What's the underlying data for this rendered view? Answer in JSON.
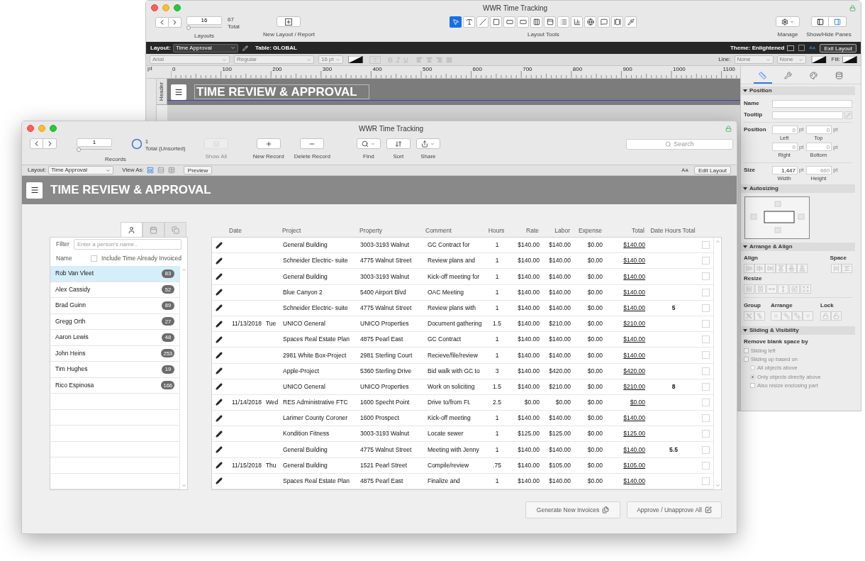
{
  "back_window": {
    "title": "WWR Time Tracking",
    "toolbar": {
      "layout_slider": {
        "value": "16",
        "level": 0.0
      },
      "layout_total": "67",
      "total_label": "Total",
      "layouts_label": "Layouts",
      "new_layout_label": "New Layout / Report",
      "layout_tools_label": "Layout Tools",
      "manage_label": "Manage",
      "panes_label": "Show/Hide Panes",
      "tools": [
        {
          "kind": "pointer",
          "selected": true
        },
        {
          "kind": "text",
          "selected": false
        },
        {
          "kind": "line",
          "selected": false
        },
        {
          "kind": "shape",
          "selected": false
        },
        {
          "kind": "field",
          "selected": false
        },
        {
          "kind": "button",
          "selected": false
        },
        {
          "kind": "button_bar",
          "selected": false
        },
        {
          "kind": "tab",
          "selected": false
        },
        {
          "kind": "portal",
          "selected": false
        },
        {
          "kind": "chart",
          "selected": false
        },
        {
          "kind": "web",
          "selected": false
        },
        {
          "kind": "popover",
          "selected": false
        },
        {
          "kind": "slide",
          "selected": false
        },
        {
          "kind": "eyedropper",
          "selected": false
        }
      ]
    },
    "layout_bar": {
      "layout_label": "Layout:",
      "layout": "Time Approval",
      "table": "Table: GLOBAL",
      "theme": "Theme: Enlightened",
      "exit": "Exit Layout"
    },
    "format_bar": {
      "font": "Arial",
      "style": "Regular",
      "size": "16 pt",
      "line_label": "Line:",
      "line": "None",
      "line_2": "None",
      "fill_label": "Fill:"
    },
    "ruler": {
      "unit": "pt",
      "ticks": [
        "0",
        "100",
        "200",
        "300",
        "400",
        "500",
        "600",
        "700",
        "800",
        "900",
        "1000",
        "1100"
      ]
    },
    "part_label": "Header",
    "header_title": "TIME REVIEW & APPROVAL",
    "inspector": {
      "tabs": [
        {
          "kind": "position",
          "selected": true
        },
        {
          "kind": "styles",
          "selected": false
        },
        {
          "kind": "appearance",
          "selected": false
        },
        {
          "kind": "data",
          "selected": false
        }
      ],
      "position": {
        "title": "Position",
        "name_label": "Name",
        "tooltip_label": "Tooltip",
        "position_label": "Position",
        "size_label": "Size",
        "position_fields": [
          {
            "value": "0",
            "unit": "pt",
            "label": "Left",
            "disabled": true
          },
          {
            "value": "0",
            "unit": "pt",
            "label": "Top",
            "disabled": true
          },
          {
            "value": "0",
            "unit": "pt",
            "label": "Right",
            "disabled": true
          },
          {
            "value": "0",
            "unit": "pt",
            "label": "Bottom",
            "disabled": true
          }
        ],
        "size_fields": [
          {
            "value": "1,447",
            "unit": "pt",
            "label": "Width",
            "disabled": false
          },
          {
            "value": "660",
            "unit": "pt",
            "label": "Height",
            "disabled": true
          }
        ]
      },
      "autosizing": {
        "title": "Autosizing"
      },
      "arrange": {
        "title": "Arrange & Align",
        "align_label": "Align",
        "space_label": "Space",
        "resize_label": "Resize",
        "group_label": "Group",
        "arrange_label": "Arrange",
        "lock_label": "Lock"
      },
      "sliding": {
        "title": "Sliding & Visibility",
        "remove_label": "Remove blank space by",
        "options": [
          {
            "kind": "checkbox",
            "label": "Sliding left",
            "checked": false
          },
          {
            "kind": "checkbox",
            "label": "Sliding up based on",
            "checked": false
          },
          {
            "kind": "radio",
            "label": "All objects above",
            "selected": false
          },
          {
            "kind": "radio",
            "label": "Only objects directly above",
            "selected": true
          },
          {
            "kind": "checkbox",
            "label": "Also resize enclosing part",
            "checked": false
          }
        ]
      }
    }
  },
  "front_window": {
    "title": "WWR Time Tracking",
    "toolbar": {
      "record_slider": {
        "value": "1",
        "level": 0.0
      },
      "found": "1",
      "total_label": "Total (Unsorted)",
      "records_label": "Records",
      "buttons": [
        {
          "kind": "show_all",
          "label": "Show All",
          "disabled": true
        },
        {
          "kind": "new",
          "label": "New Record",
          "disabled": false
        },
        {
          "kind": "delete",
          "label": "Delete Record",
          "disabled": false
        },
        {
          "kind": "find",
          "label": "Find",
          "disabled": false
        },
        {
          "kind": "sort",
          "label": "Sort",
          "disabled": false
        },
        {
          "kind": "share",
          "label": "Share",
          "disabled": false
        }
      ],
      "search": {
        "placeholder": "Search"
      }
    },
    "layout_bar": {
      "layout_label": "Layout:",
      "layout": "Time Approval",
      "view_label": "View As:",
      "views": [
        {
          "kind": "form",
          "selected": true
        },
        {
          "kind": "list",
          "selected": false
        },
        {
          "kind": "table",
          "selected": false
        }
      ],
      "preview": "Preview",
      "edit_layout": "Edit Layout"
    },
    "header_title": "TIME REVIEW & APPROVAL",
    "people_panel": {
      "tabs": [
        {
          "kind": "person",
          "selected": true
        },
        {
          "kind": "calendar",
          "selected": false
        },
        {
          "kind": "project",
          "selected": false
        }
      ],
      "filter_label": "Filter",
      "filter": {
        "placeholder": "Enter a person's name.."
      },
      "name_label": "Name",
      "include_invoiced": {
        "label": "Include Time Already Invoiced",
        "checked": false
      },
      "people": [
        {
          "name": "Rob Van Vleet",
          "count": "83",
          "selected": true
        },
        {
          "name": "Alex Cassidy",
          "count": "52",
          "selected": false
        },
        {
          "name": "Brad Guinn",
          "count": "89",
          "selected": false
        },
        {
          "name": "Gregg Orth",
          "count": "27",
          "selected": false
        },
        {
          "name": "Aaron Lewis",
          "count": "48",
          "selected": false
        },
        {
          "name": "John Heins",
          "count": "253",
          "selected": false
        },
        {
          "name": "Tim Hughes",
          "count": "19",
          "selected": false
        },
        {
          "name": "Rico Espinosa",
          "count": "166",
          "selected": false
        }
      ]
    },
    "table": {
      "columns": [
        "Date",
        "Project",
        "Property",
        "Comment",
        "Hours",
        "Rate",
        "Labor",
        "Expense",
        "Total",
        "Date Hours Total"
      ],
      "rows": [
        {
          "project": "General Building",
          "property": "3003-3193 Walnut",
          "comment": "GC Contract for",
          "hours": "1",
          "rate": "$140.00",
          "labor": "$140.00",
          "expense": "$0.00",
          "total": "$140.00",
          "checked": false
        },
        {
          "project": "Schneider Electric- suite",
          "property": "4775 Walnut Street",
          "comment": "Review plans and",
          "hours": "1",
          "rate": "$140.00",
          "labor": "$140.00",
          "expense": "$0.00",
          "total": "$140.00",
          "checked": false
        },
        {
          "project": "General Building",
          "property": "3003-3193 Walnut",
          "comment": "Kick-off meeting for",
          "hours": "1",
          "rate": "$140.00",
          "labor": "$140.00",
          "expense": "$0.00",
          "total": "$140.00",
          "checked": false
        },
        {
          "project": "Blue Canyon 2",
          "property": "5400 Airport Blvd",
          "comment": "OAC Meeting",
          "hours": "1",
          "rate": "$140.00",
          "labor": "$140.00",
          "expense": "$0.00",
          "total": "$140.00",
          "checked": false
        },
        {
          "project": "Schneider Electric- suite",
          "property": "4775 Walnut Street",
          "comment": "Review plans with",
          "hours": "1",
          "rate": "$140.00",
          "labor": "$140.00",
          "expense": "$0.00",
          "total": "$140.00",
          "date_total": "5",
          "checked": false
        },
        {
          "date": "11/13/2018",
          "day": "Tue",
          "project": "UNICO General",
          "property": "UNICO Properties",
          "comment": "Document gathering",
          "hours": "1.5",
          "rate": "$140.00",
          "labor": "$210.00",
          "expense": "$0.00",
          "total": "$210.00",
          "checked": false
        },
        {
          "project": "Spaces Real Estate Plan",
          "property": "4875 Pearl East",
          "comment": "GC Contract",
          "hours": "1",
          "rate": "$140.00",
          "labor": "$140.00",
          "expense": "$0.00",
          "total": "$140.00",
          "checked": false
        },
        {
          "project": "2981 White Box-Project",
          "property": "2981 Sterling Court",
          "comment": "Recieve/file/review",
          "hours": "1",
          "rate": "$140.00",
          "labor": "$140.00",
          "expense": "$0.00",
          "total": "$140.00",
          "checked": false
        },
        {
          "project": "Apple-Project",
          "property": "5360 Sterling Drive",
          "comment": "Bid walk with GC to",
          "hours": "3",
          "rate": "$140.00",
          "labor": "$420.00",
          "expense": "$0.00",
          "total": "$420.00",
          "checked": false
        },
        {
          "project": "UNICO General",
          "property": "UNICO Properties",
          "comment": "Work on soliciting",
          "hours": "1.5",
          "rate": "$140.00",
          "labor": "$210.00",
          "expense": "$0.00",
          "total": "$210.00",
          "date_total": "8",
          "checked": false
        },
        {
          "date": "11/14/2018",
          "day": "Wed",
          "project": "RES Administrative FTC",
          "property": "1600 Specht Point",
          "comment": "Drive to/from Ft.",
          "hours": "2.5",
          "rate": "$0.00",
          "labor": "$0.00",
          "expense": "$0.00",
          "total": "$0.00",
          "checked": false
        },
        {
          "project": "Larimer County Coroner",
          "property": "1600 Prospect",
          "comment": "Kick-off meeting",
          "hours": "1",
          "rate": "$140.00",
          "labor": "$140.00",
          "expense": "$0.00",
          "total": "$140.00",
          "checked": false
        },
        {
          "project": "Kondition Fitness",
          "property": "3003-3193 Walnut",
          "comment": "Locate sewer",
          "hours": "1",
          "rate": "$125.00",
          "labor": "$125.00",
          "expense": "$0.00",
          "total": "$125.00",
          "checked": false
        },
        {
          "project": "General Building",
          "property": "4775 Walnut Street",
          "comment": "Meeting with Jenny",
          "hours": "1",
          "rate": "$140.00",
          "labor": "$140.00",
          "expense": "$0.00",
          "total": "$140.00",
          "date_total": "5.5",
          "checked": false
        },
        {
          "date": "11/15/2018",
          "day": "Thu",
          "project": "General Building",
          "property": "1521 Pearl Street",
          "comment": "Compile/review",
          "hours": ".75",
          "rate": "$140.00",
          "labor": "$105.00",
          "expense": "$0.00",
          "total": "$105.00",
          "checked": false
        },
        {
          "project": "Spaces Real Estate Plan",
          "property": "4875 Pearl East",
          "comment": "Finalize and",
          "hours": "1",
          "rate": "$140.00",
          "labor": "$140.00",
          "expense": "$0.00",
          "total": "$140.00",
          "checked": false
        }
      ]
    },
    "buttons": [
      {
        "kind": "invoice",
        "label": "Generate New Invoices"
      },
      {
        "kind": "approve",
        "label": "Approve / Unapprove All"
      }
    ]
  }
}
